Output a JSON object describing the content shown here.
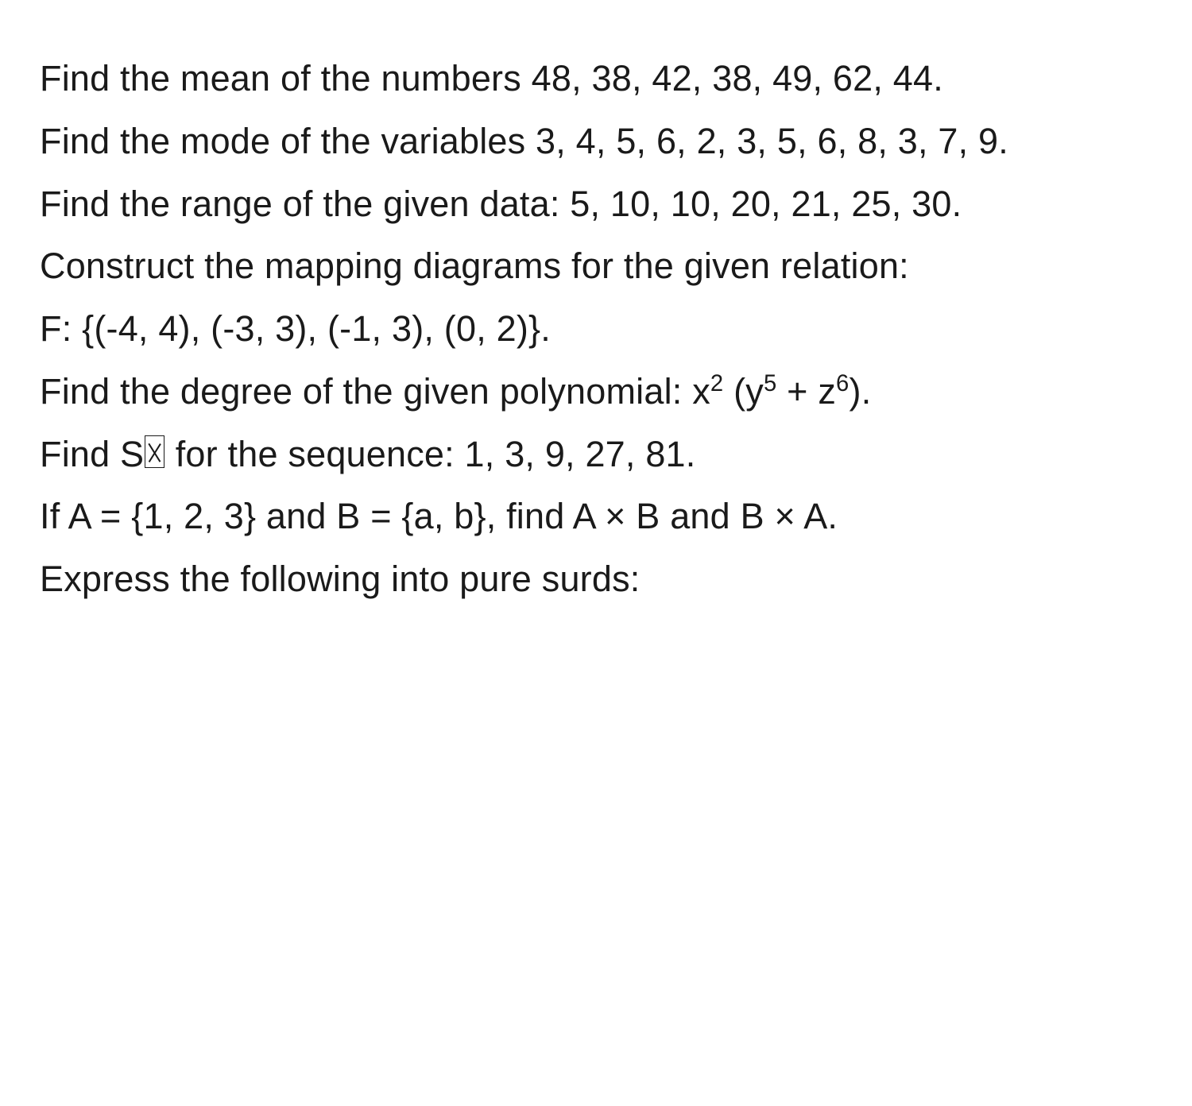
{
  "questions": {
    "q1": "Find the mean of the numbers 48, 38, 42, 38, 49, 62, 44.",
    "q2": "Find the mode of the variables 3, 4, 5, 6, 2, 3, 5, 6, 8, 3, 7, 9.",
    "q3": "Find the range of the given data: 5, 10, 10, 20, 21, 25, 30.",
    "q4": "Construct the mapping diagrams for the given relation:",
    "q4_relation": "F: {(-4, 4), (-3, 3), (-1, 3), (0, 2)}.",
    "q5_pre": "Find the degree of the given polynomial: x",
    "q5_exp1": "2",
    "q5_mid1": " (y",
    "q5_exp2": "5",
    "q5_mid2": " + z",
    "q5_exp3": "6",
    "q5_post": ").",
    "q6_pre": "Find S",
    "q6_post": " for the sequence: 1, 3, 9, 27, 81.",
    "q7": "If A = {1, 2, 3} and B = {a, b}, find A × B and B × A.",
    "q8": "Express the following into pure surds:"
  }
}
